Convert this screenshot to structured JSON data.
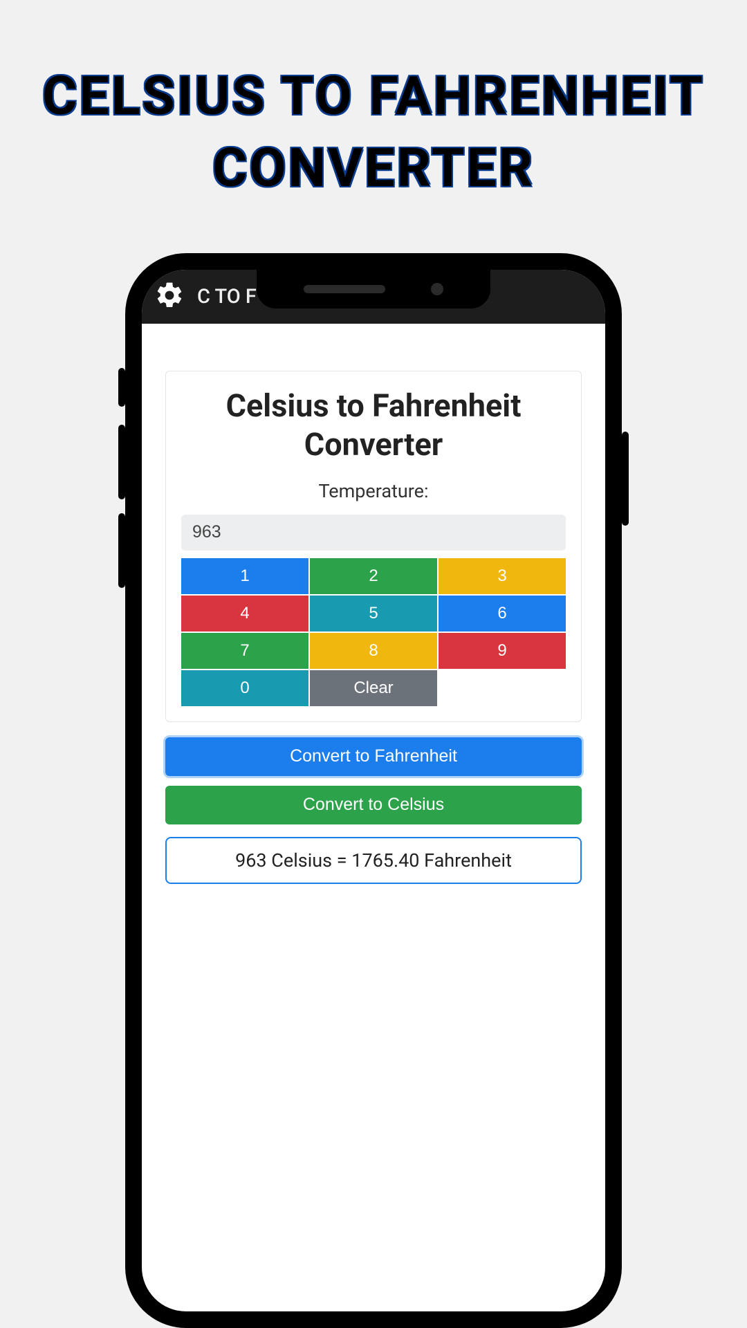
{
  "headline": {
    "line1": "CELSIUS TO FAHRENHEIT",
    "line2": "CONVERTER"
  },
  "statusbar": {
    "app_title": "C TO F Converter",
    "settings_icon": "gear-icon"
  },
  "card": {
    "title": "Celsius to Fahrenheit Converter",
    "temperature_label": "Temperature:",
    "temperature_value": "963"
  },
  "keypad": {
    "keys": [
      {
        "label": "1",
        "color": "c-blue"
      },
      {
        "label": "2",
        "color": "c-green"
      },
      {
        "label": "3",
        "color": "c-yellow"
      },
      {
        "label": "4",
        "color": "c-red"
      },
      {
        "label": "5",
        "color": "c-teal"
      },
      {
        "label": "6",
        "color": "c-blue"
      },
      {
        "label": "7",
        "color": "c-green"
      },
      {
        "label": "8",
        "color": "c-yellow"
      },
      {
        "label": "9",
        "color": "c-red"
      },
      {
        "label": "0",
        "color": "c-teal"
      },
      {
        "label": "Clear",
        "color": "c-gray"
      }
    ]
  },
  "actions": {
    "to_f": "Convert to Fahrenheit",
    "to_c": "Convert to Celsius"
  },
  "result_text": "963 Celsius = 1765.40 Fahrenheit"
}
